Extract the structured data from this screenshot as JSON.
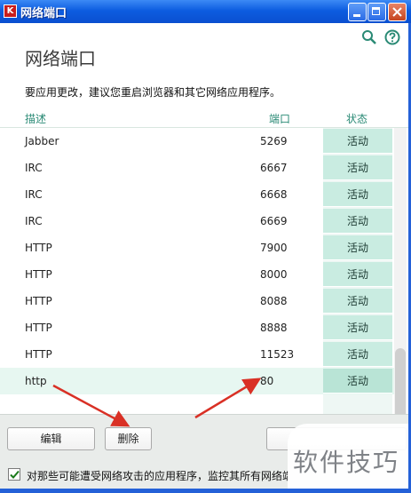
{
  "window": {
    "title": "网络端口",
    "app_icon_letter": "K"
  },
  "header": {
    "title": "网络端口",
    "notice": "要应用更改，建议您重启浏览器和其它网络应用程序。"
  },
  "table": {
    "columns": {
      "desc": "描述",
      "port": "端口",
      "state": "状态"
    },
    "rows": [
      {
        "desc": "Jabber",
        "port": "5269",
        "state": "活动"
      },
      {
        "desc": "IRC",
        "port": "6667",
        "state": "活动"
      },
      {
        "desc": "IRC",
        "port": "6668",
        "state": "活动"
      },
      {
        "desc": "IRC",
        "port": "6669",
        "state": "活动"
      },
      {
        "desc": "HTTP",
        "port": "7900",
        "state": "活动"
      },
      {
        "desc": "HTTP",
        "port": "8000",
        "state": "活动"
      },
      {
        "desc": "HTTP",
        "port": "8088",
        "state": "活动"
      },
      {
        "desc": "HTTP",
        "port": "8888",
        "state": "活动"
      },
      {
        "desc": "HTTP",
        "port": "11523",
        "state": "活动"
      },
      {
        "desc": "http",
        "port": "80",
        "state": "活动"
      }
    ],
    "selected_row_index": 9
  },
  "buttons": {
    "edit": "编辑",
    "delete": "删除",
    "add": ""
  },
  "option": {
    "label": "对那些可能遭受网络攻击的应用程序，监控其所有网络端",
    "checked": true
  },
  "watermark": {
    "text": "软件技巧"
  },
  "colors": {
    "accent": "#2a8a75",
    "status_bg": "#c9ece1",
    "arrow": "#d93025",
    "titlebar": "#0d5de0"
  },
  "icons": {
    "search": "search-icon",
    "help": "help-icon"
  }
}
